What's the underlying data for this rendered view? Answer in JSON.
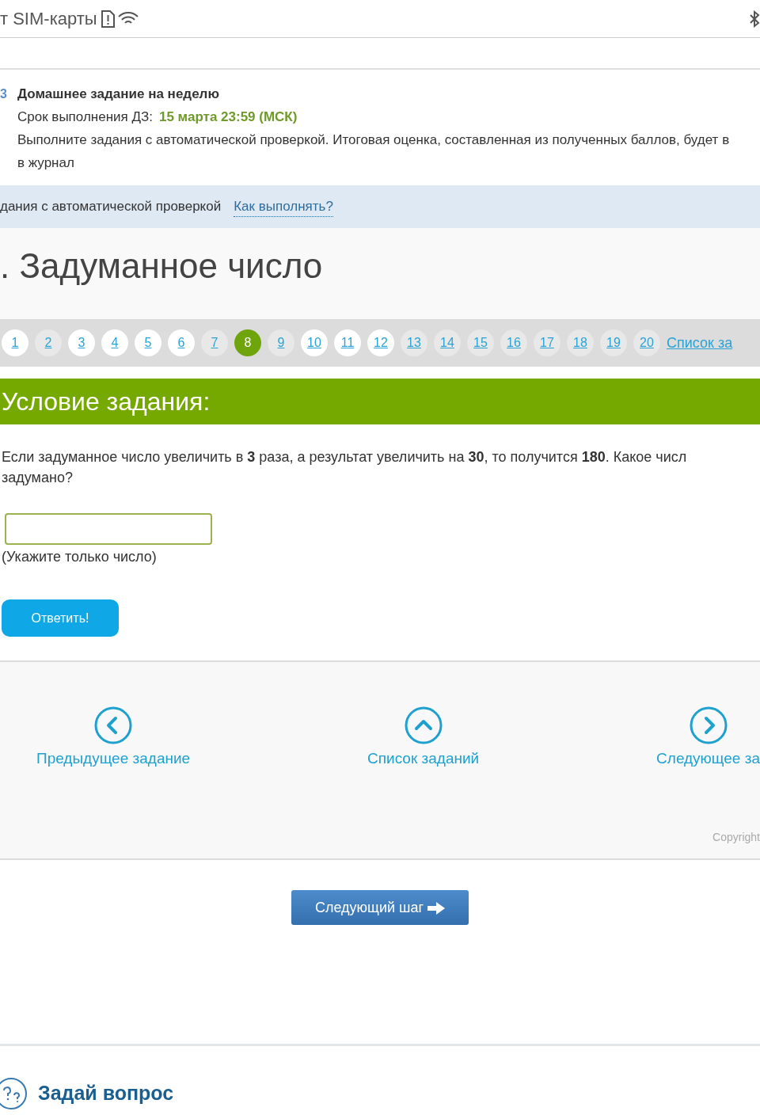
{
  "status_bar": {
    "carrier": "т SIM-карты"
  },
  "homework": {
    "number": "3",
    "title": "Домашнее задание на неделю",
    "deadline_label": "Срок выполнения ДЗ:",
    "deadline": "15 марта 23:59 (МСК)",
    "description": "Выполните задания с автоматической проверкой. Итоговая оценка, составленная из полученных баллов, будет в\nв журнал"
  },
  "info_bar": {
    "text": "дания с автоматической проверкой",
    "link": "Как выполнять?"
  },
  "task_title": ". Задуманное число",
  "pager": {
    "pages": [
      {
        "label": "1",
        "visited": true,
        "selected": false
      },
      {
        "label": "2",
        "visited": false,
        "selected": false
      },
      {
        "label": "3",
        "visited": true,
        "selected": false
      },
      {
        "label": "4",
        "visited": true,
        "selected": false
      },
      {
        "label": "5",
        "visited": true,
        "selected": false
      },
      {
        "label": "6",
        "visited": true,
        "selected": false
      },
      {
        "label": "7",
        "visited": false,
        "selected": false
      },
      {
        "label": "8",
        "visited": false,
        "selected": true
      },
      {
        "label": "9",
        "visited": false,
        "selected": false
      },
      {
        "label": "10",
        "visited": true,
        "selected": false
      },
      {
        "label": "11",
        "visited": true,
        "selected": false
      },
      {
        "label": "12",
        "visited": true,
        "selected": false
      },
      {
        "label": "13",
        "visited": false,
        "selected": false
      },
      {
        "label": "14",
        "visited": false,
        "selected": false
      },
      {
        "label": "15",
        "visited": false,
        "selected": false
      },
      {
        "label": "16",
        "visited": false,
        "selected": false
      },
      {
        "label": "17",
        "visited": false,
        "selected": false
      },
      {
        "label": "18",
        "visited": false,
        "selected": false
      },
      {
        "label": "19",
        "visited": false,
        "selected": false
      },
      {
        "label": "20",
        "visited": false,
        "selected": false
      }
    ],
    "list_link": "Список за"
  },
  "condition": {
    "heading": "Условие задания:",
    "text": "Если задуманное число увеличить в **3** раза, а результат увеличить на **30**, то получится **180**. Какое числ\nзадумано?",
    "hint": "(Укажите только число)",
    "submit": "Ответить!"
  },
  "navigation": {
    "prev": "Предыдущее задание",
    "list": "Список заданий",
    "next": "Следующее за",
    "copyright": "Copyright"
  },
  "next_step": "Следующий шаг",
  "ask": {
    "title": "Задай вопрос"
  }
}
